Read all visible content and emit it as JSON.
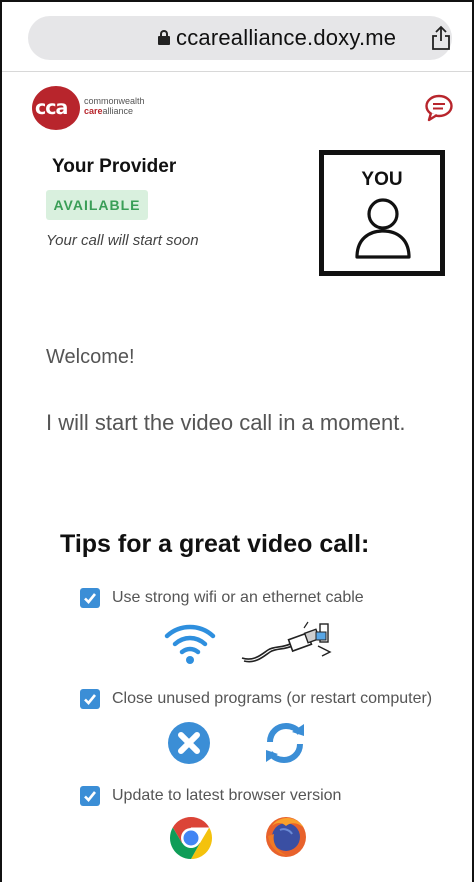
{
  "browser": {
    "url": "ccarealliance.doxy.me"
  },
  "logo": {
    "mark": "cca",
    "line1": "commonwealth",
    "line2_care": "care",
    "line2_rest": "alliance"
  },
  "provider": {
    "title": "Your Provider",
    "status": "AVAILABLE",
    "subtitle": "Your call will start soon"
  },
  "self_view": {
    "label": "YOU"
  },
  "welcome": {
    "heading": "Welcome!",
    "message": "I will start the video call in a moment."
  },
  "tips": {
    "title": "Tips for a great video call:",
    "items": [
      {
        "text": "Use strong wifi or an ethernet cable",
        "icons": [
          "wifi-icon",
          "ethernet-cable-icon"
        ]
      },
      {
        "text": "Close unused programs (or restart computer)",
        "icons": [
          "close-circle-icon",
          "refresh-icon"
        ]
      },
      {
        "text": "Update to latest browser version",
        "icons": [
          "chrome-icon",
          "firefox-icon"
        ]
      }
    ]
  },
  "colors": {
    "brand_red": "#b8252c",
    "available_green": "#3a9e57",
    "tip_blue": "#3b8ed6"
  }
}
